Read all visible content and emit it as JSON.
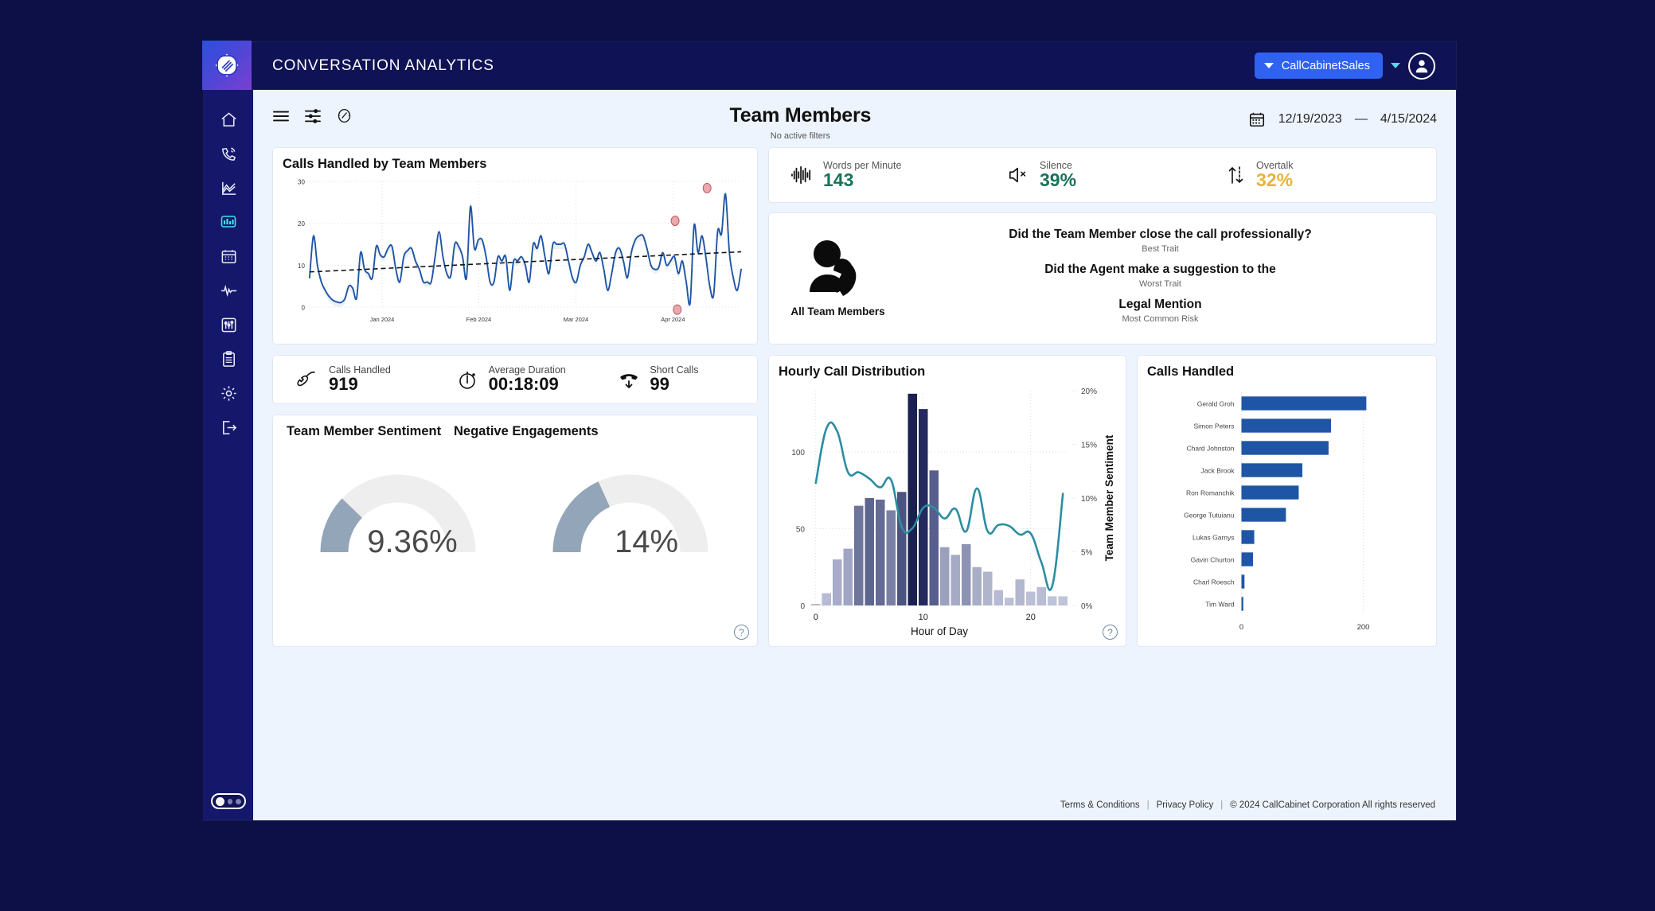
{
  "header": {
    "app_title": "CONVERSATION ANALYTICS",
    "logo_icon": "callcabinet-logo-icon",
    "tenant_label": "CallCabinetSales",
    "tenant_caret_icon": "caret-down-icon",
    "user_caret_icon": "caret-down-icon",
    "avatar_icon": "user-avatar-icon"
  },
  "sidebar": {
    "items": [
      {
        "name": "home",
        "icon": "home-icon",
        "active": false
      },
      {
        "name": "calls",
        "icon": "phone-signal-icon",
        "active": false
      },
      {
        "name": "analytics",
        "icon": "line-chart-icon",
        "active": false
      },
      {
        "name": "dashboards",
        "icon": "bar-chart-icon",
        "active": true
      },
      {
        "name": "calendar",
        "icon": "calendar-icon",
        "active": false
      },
      {
        "name": "pulse",
        "icon": "waveform-pulse-icon",
        "active": false
      },
      {
        "name": "settings-sliders",
        "icon": "sliders-panel-icon",
        "active": false
      },
      {
        "name": "reports",
        "icon": "clipboard-list-icon",
        "active": false
      },
      {
        "name": "preferences",
        "icon": "gear-icon",
        "active": false
      },
      {
        "name": "logout",
        "icon": "logout-icon",
        "active": false
      }
    ],
    "toggle_icon": "carousel-toggle-icon"
  },
  "toolbar": {
    "menu_icon": "hamburger-menu-icon",
    "filters_icon": "filter-sliders-icon",
    "gauge_icon": "speedometer-icon"
  },
  "page": {
    "title": "Team Members",
    "subtitle": "No active filters"
  },
  "date_range": {
    "calendar_icon": "calendar-icon",
    "start": "12/19/2023",
    "separator": "—",
    "end": "4/15/2024"
  },
  "metrics": [
    {
      "icon": "audio-waveform-icon",
      "label": "Words per Minute",
      "value": "143",
      "color": "#19735a"
    },
    {
      "icon": "speaker-mute-icon",
      "label": "Silence",
      "value": "39%",
      "color": "#19735a"
    },
    {
      "icon": "overtalk-arrows-icon",
      "label": "Overtalk",
      "value": "32%",
      "color": "#e8b33c"
    }
  ],
  "traits": {
    "person_icon": "person-phone-icon",
    "scope_label": "All Team Members",
    "items": [
      {
        "question": "Did the Team Member close the call professionally?",
        "caption": "Best Trait"
      },
      {
        "question": "Did the Agent make a suggestion to the",
        "caption": "Worst Trait"
      },
      {
        "question": "Legal Mention",
        "caption": "Most Common Risk"
      }
    ]
  },
  "stats": [
    {
      "icon": "phone-handset-icon",
      "label": "Calls Handled",
      "value": "919"
    },
    {
      "icon": "stopwatch-icon",
      "label": "Average Duration",
      "value": "00:18:09"
    },
    {
      "icon": "phone-down-arrow-icon",
      "label": "Short Calls",
      "value": "99"
    }
  ],
  "gauges": {
    "help_icon": "help-question-icon",
    "items": [
      {
        "title": "Team Member Sentiment",
        "value_label": "9.36%",
        "fraction": 0.0936
      },
      {
        "title": "Negative Engagements",
        "value_label": "14%",
        "fraction": 0.14
      }
    ]
  },
  "chart_data": [
    {
      "id": "calls-handled-by-team-members",
      "type": "line",
      "title": "Calls Handled by Team Members",
      "xlabel": "",
      "ylabel": "",
      "ylim": [
        0,
        30
      ],
      "yticks": [
        0,
        10,
        20,
        30
      ],
      "ytick_labels": [
        "0",
        "10",
        "20",
        "30"
      ],
      "xtick_labels": [
        "Jan 2024",
        "Feb 2024",
        "Mar 2024",
        "Apr 2024"
      ],
      "xtick_positions": [
        0.168,
        0.392,
        0.617,
        0.842
      ],
      "grid": true,
      "line_color": "#1f55a5",
      "band_color": "#d8dde4",
      "trend": {
        "style": "dashed",
        "color": "#111111",
        "y_start": 8.4,
        "y_end": 13.2
      },
      "anomalies": [
        {
          "x_frac": 0.847,
          "y": 20.6,
          "color": "#e9a9ad"
        },
        {
          "x_frac": 0.852,
          "y": -0.6,
          "color": "#e9a9ad"
        },
        {
          "x_frac": 0.921,
          "y": 28.4,
          "color": "#e9a9ad"
        }
      ],
      "values": [
        7,
        17,
        10,
        6,
        4,
        2.5,
        1.6,
        1.2,
        1.1,
        2,
        5,
        4.5,
        2.2,
        13,
        9,
        8,
        7,
        14.5,
        12.5,
        12,
        14,
        14.5,
        9,
        6,
        12,
        13.5,
        14,
        11,
        9,
        6,
        6,
        6,
        12,
        18,
        12,
        8,
        7.5,
        15,
        14.5,
        12,
        7,
        24,
        14,
        16,
        16,
        12,
        6,
        6,
        12,
        11,
        12,
        4,
        11,
        11,
        12,
        10,
        6,
        15,
        14,
        17,
        12,
        8,
        15,
        15,
        15,
        15,
        11,
        7,
        6,
        10,
        12,
        15,
        13,
        11,
        13,
        9,
        4,
        8,
        13,
        14,
        11,
        7,
        13,
        16,
        17,
        17,
        14,
        10,
        9,
        9.5,
        13,
        10,
        11,
        12,
        8,
        11,
        6,
        1,
        19.5,
        13,
        17,
        12,
        5,
        3,
        18,
        17.5,
        27,
        13,
        7,
        4,
        9
      ]
    },
    {
      "id": "hourly-call-distribution",
      "type": "bar",
      "title": "Hourly Call Distribution",
      "xlabel": "Hour of Day",
      "ylabel": "",
      "y2label": "Team Member Sentiment",
      "ylim": [
        0,
        140
      ],
      "yticks": [
        0,
        50,
        100
      ],
      "ytick_labels": [
        "0",
        "50",
        "100"
      ],
      "y2lim": [
        0,
        20
      ],
      "y2ticks": [
        0,
        5,
        10,
        15,
        20
      ],
      "y2tick_labels": [
        "0%",
        "5%",
        "10%",
        "15%",
        "20%"
      ],
      "xticks": [
        0,
        10,
        20
      ],
      "xtick_labels": [
        "0",
        "10",
        "20"
      ],
      "categories": [
        0,
        1,
        2,
        3,
        4,
        5,
        6,
        7,
        8,
        9,
        10,
        11,
        12,
        13,
        14,
        15,
        16,
        17,
        18,
        19,
        20,
        21,
        22,
        23
      ],
      "values": [
        1,
        8,
        30,
        37,
        65,
        70,
        69,
        62,
        74,
        138,
        128,
        88,
        38,
        33,
        40,
        25,
        22,
        10,
        5,
        17,
        9,
        12,
        6,
        6
      ],
      "bar_colors": [
        "#b6bad2",
        "#b6bad2",
        "#a8acc8",
        "#a0a5c4",
        "#6f7499",
        "#5f6591",
        "#656b96",
        "#7a7fa5",
        "#4d5380",
        "#1a2050",
        "#242a5e",
        "#575d8d",
        "#9ba0bd",
        "#a6abc5",
        "#8e93b4",
        "#a9aec7",
        "#b0b5cc",
        "#b6bad2",
        "#bcc0d6",
        "#b2b7cf",
        "#bcc0d6",
        "#b8bcd4",
        "#c0c4d9",
        "#c0c4d9"
      ],
      "line_name": "Team Member Sentiment",
      "line_color": "#2b8ea0",
      "line_values": [
        11.4,
        16.5,
        16.2,
        12.4,
        12.4,
        11.8,
        11.0,
        11.7,
        7.3,
        7.2,
        9.1,
        9.1,
        8.1,
        9.0,
        6.9,
        10.9,
        6.9,
        7.5,
        7.4,
        6.6,
        6.7,
        4.0,
        1.8,
        10.4
      ]
    },
    {
      "id": "calls-handled-by-member",
      "type": "bar",
      "orientation": "horizontal",
      "title": "Calls Handled",
      "xlim": [
        0,
        230
      ],
      "xticks": [
        0,
        200
      ],
      "xtick_labels": [
        "0",
        "200"
      ],
      "bar_color": "#1f55a5",
      "categories": [
        "Gerald Groh",
        "Simon Peters",
        "Chard Johnston",
        "Jack Brook",
        "Ron Romanchik",
        "George Tutuianu",
        "Lukas Garnys",
        "Gavin Churton",
        "Charl Roesch",
        "Tim Ward"
      ],
      "values": [
        205,
        147,
        143,
        100,
        94,
        73,
        21,
        19,
        5,
        3
      ]
    }
  ],
  "footer": {
    "terms": "Terms & Conditions",
    "privacy": "Privacy Policy",
    "copyright": "© 2024 CallCabinet Corporation All rights reserved",
    "sep": "|"
  }
}
